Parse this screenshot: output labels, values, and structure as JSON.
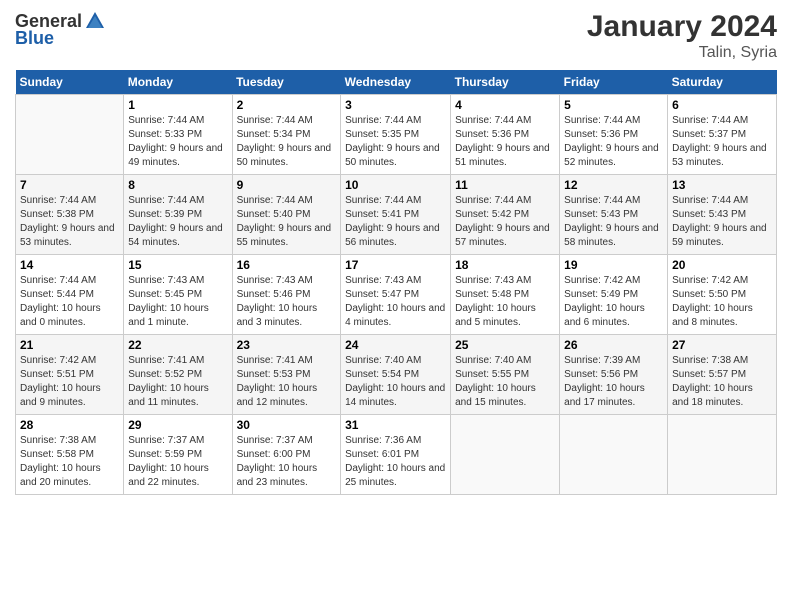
{
  "logo": {
    "text_general": "General",
    "text_blue": "Blue"
  },
  "title": "January 2024",
  "subtitle": "Talin, Syria",
  "days_of_week": [
    "Sunday",
    "Monday",
    "Tuesday",
    "Wednesday",
    "Thursday",
    "Friday",
    "Saturday"
  ],
  "weeks": [
    [
      {
        "num": "",
        "sunrise": "",
        "sunset": "",
        "daylight": ""
      },
      {
        "num": "1",
        "sunrise": "Sunrise: 7:44 AM",
        "sunset": "Sunset: 5:33 PM",
        "daylight": "Daylight: 9 hours and 49 minutes."
      },
      {
        "num": "2",
        "sunrise": "Sunrise: 7:44 AM",
        "sunset": "Sunset: 5:34 PM",
        "daylight": "Daylight: 9 hours and 50 minutes."
      },
      {
        "num": "3",
        "sunrise": "Sunrise: 7:44 AM",
        "sunset": "Sunset: 5:35 PM",
        "daylight": "Daylight: 9 hours and 50 minutes."
      },
      {
        "num": "4",
        "sunrise": "Sunrise: 7:44 AM",
        "sunset": "Sunset: 5:36 PM",
        "daylight": "Daylight: 9 hours and 51 minutes."
      },
      {
        "num": "5",
        "sunrise": "Sunrise: 7:44 AM",
        "sunset": "Sunset: 5:36 PM",
        "daylight": "Daylight: 9 hours and 52 minutes."
      },
      {
        "num": "6",
        "sunrise": "Sunrise: 7:44 AM",
        "sunset": "Sunset: 5:37 PM",
        "daylight": "Daylight: 9 hours and 53 minutes."
      }
    ],
    [
      {
        "num": "7",
        "sunrise": "Sunrise: 7:44 AM",
        "sunset": "Sunset: 5:38 PM",
        "daylight": "Daylight: 9 hours and 53 minutes."
      },
      {
        "num": "8",
        "sunrise": "Sunrise: 7:44 AM",
        "sunset": "Sunset: 5:39 PM",
        "daylight": "Daylight: 9 hours and 54 minutes."
      },
      {
        "num": "9",
        "sunrise": "Sunrise: 7:44 AM",
        "sunset": "Sunset: 5:40 PM",
        "daylight": "Daylight: 9 hours and 55 minutes."
      },
      {
        "num": "10",
        "sunrise": "Sunrise: 7:44 AM",
        "sunset": "Sunset: 5:41 PM",
        "daylight": "Daylight: 9 hours and 56 minutes."
      },
      {
        "num": "11",
        "sunrise": "Sunrise: 7:44 AM",
        "sunset": "Sunset: 5:42 PM",
        "daylight": "Daylight: 9 hours and 57 minutes."
      },
      {
        "num": "12",
        "sunrise": "Sunrise: 7:44 AM",
        "sunset": "Sunset: 5:43 PM",
        "daylight": "Daylight: 9 hours and 58 minutes."
      },
      {
        "num": "13",
        "sunrise": "Sunrise: 7:44 AM",
        "sunset": "Sunset: 5:43 PM",
        "daylight": "Daylight: 9 hours and 59 minutes."
      }
    ],
    [
      {
        "num": "14",
        "sunrise": "Sunrise: 7:44 AM",
        "sunset": "Sunset: 5:44 PM",
        "daylight": "Daylight: 10 hours and 0 minutes."
      },
      {
        "num": "15",
        "sunrise": "Sunrise: 7:43 AM",
        "sunset": "Sunset: 5:45 PM",
        "daylight": "Daylight: 10 hours and 1 minute."
      },
      {
        "num": "16",
        "sunrise": "Sunrise: 7:43 AM",
        "sunset": "Sunset: 5:46 PM",
        "daylight": "Daylight: 10 hours and 3 minutes."
      },
      {
        "num": "17",
        "sunrise": "Sunrise: 7:43 AM",
        "sunset": "Sunset: 5:47 PM",
        "daylight": "Daylight: 10 hours and 4 minutes."
      },
      {
        "num": "18",
        "sunrise": "Sunrise: 7:43 AM",
        "sunset": "Sunset: 5:48 PM",
        "daylight": "Daylight: 10 hours and 5 minutes."
      },
      {
        "num": "19",
        "sunrise": "Sunrise: 7:42 AM",
        "sunset": "Sunset: 5:49 PM",
        "daylight": "Daylight: 10 hours and 6 minutes."
      },
      {
        "num": "20",
        "sunrise": "Sunrise: 7:42 AM",
        "sunset": "Sunset: 5:50 PM",
        "daylight": "Daylight: 10 hours and 8 minutes."
      }
    ],
    [
      {
        "num": "21",
        "sunrise": "Sunrise: 7:42 AM",
        "sunset": "Sunset: 5:51 PM",
        "daylight": "Daylight: 10 hours and 9 minutes."
      },
      {
        "num": "22",
        "sunrise": "Sunrise: 7:41 AM",
        "sunset": "Sunset: 5:52 PM",
        "daylight": "Daylight: 10 hours and 11 minutes."
      },
      {
        "num": "23",
        "sunrise": "Sunrise: 7:41 AM",
        "sunset": "Sunset: 5:53 PM",
        "daylight": "Daylight: 10 hours and 12 minutes."
      },
      {
        "num": "24",
        "sunrise": "Sunrise: 7:40 AM",
        "sunset": "Sunset: 5:54 PM",
        "daylight": "Daylight: 10 hours and 14 minutes."
      },
      {
        "num": "25",
        "sunrise": "Sunrise: 7:40 AM",
        "sunset": "Sunset: 5:55 PM",
        "daylight": "Daylight: 10 hours and 15 minutes."
      },
      {
        "num": "26",
        "sunrise": "Sunrise: 7:39 AM",
        "sunset": "Sunset: 5:56 PM",
        "daylight": "Daylight: 10 hours and 17 minutes."
      },
      {
        "num": "27",
        "sunrise": "Sunrise: 7:38 AM",
        "sunset": "Sunset: 5:57 PM",
        "daylight": "Daylight: 10 hours and 18 minutes."
      }
    ],
    [
      {
        "num": "28",
        "sunrise": "Sunrise: 7:38 AM",
        "sunset": "Sunset: 5:58 PM",
        "daylight": "Daylight: 10 hours and 20 minutes."
      },
      {
        "num": "29",
        "sunrise": "Sunrise: 7:37 AM",
        "sunset": "Sunset: 5:59 PM",
        "daylight": "Daylight: 10 hours and 22 minutes."
      },
      {
        "num": "30",
        "sunrise": "Sunrise: 7:37 AM",
        "sunset": "Sunset: 6:00 PM",
        "daylight": "Daylight: 10 hours and 23 minutes."
      },
      {
        "num": "31",
        "sunrise": "Sunrise: 7:36 AM",
        "sunset": "Sunset: 6:01 PM",
        "daylight": "Daylight: 10 hours and 25 minutes."
      },
      {
        "num": "",
        "sunrise": "",
        "sunset": "",
        "daylight": ""
      },
      {
        "num": "",
        "sunrise": "",
        "sunset": "",
        "daylight": ""
      },
      {
        "num": "",
        "sunrise": "",
        "sunset": "",
        "daylight": ""
      }
    ]
  ]
}
